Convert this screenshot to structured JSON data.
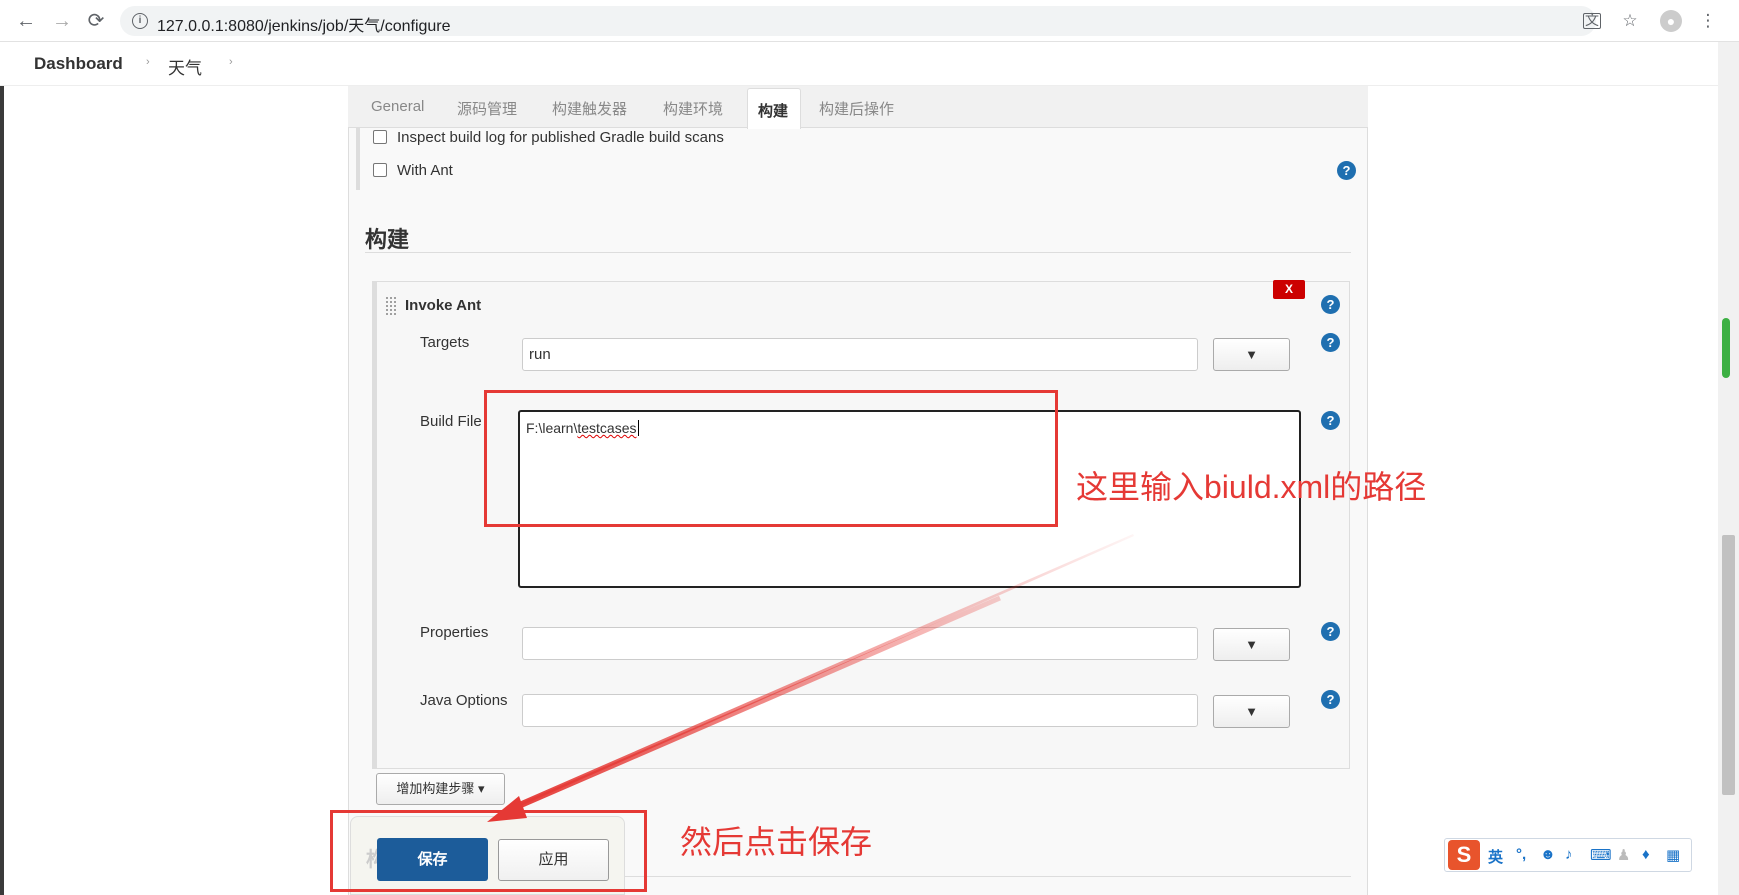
{
  "browser": {
    "url": "127.0.0.1:8080/jenkins/job/天气/configure",
    "icons": [
      "back-arrow-icon",
      "forward-arrow-icon",
      "reload-icon",
      "site-info-icon",
      "translate-icon",
      "bookmark-star-icon",
      "profile-icon",
      "menu-kebab-icon"
    ]
  },
  "breadcrumb": {
    "items": [
      "Dashboard",
      "天气"
    ]
  },
  "tabs": [
    "General",
    "源码管理",
    "构建触发器",
    "构建环境",
    "构建",
    "构建后操作"
  ],
  "active_tab": "构建",
  "build_env": {
    "checkboxes": [
      {
        "label": "Inspect build log for published Gradle build scans",
        "checked": false
      },
      {
        "label": "With Ant",
        "checked": false
      }
    ]
  },
  "build": {
    "section_title": "构建",
    "step": {
      "title": "Invoke Ant",
      "delete_label": "X",
      "targets_label": "Targets",
      "targets_value": "run",
      "build_file_label": "Build File",
      "build_file_prefix": "F:\\learn\\",
      "build_file_misspelled": "testcases",
      "properties_label": "Properties",
      "properties_value": "",
      "java_options_label": "Java Options",
      "java_options_value": "",
      "dropdown_glyph": "▼"
    },
    "add_step_label": "增加构建步骤 ▾"
  },
  "actions": {
    "save_label": "保存",
    "apply_label": "应用",
    "faded_heading": "构"
  },
  "help_glyph": "?",
  "annotations": {
    "build_file_note": "这里输入biuld.xml的路径",
    "save_note": "然后点击保存",
    "color": "#e53935"
  },
  "ime": {
    "logo": "S",
    "lang": "英",
    "items": [
      "punctuation-icon",
      "emoji-icon",
      "microphone-icon",
      "keyboard-icon",
      "user-icon",
      "skin-icon",
      "grid-icon"
    ]
  },
  "colors": {
    "save_button": "#1c5c9a",
    "delete_button": "#cc0000",
    "help_icon": "#1f6fb0"
  }
}
